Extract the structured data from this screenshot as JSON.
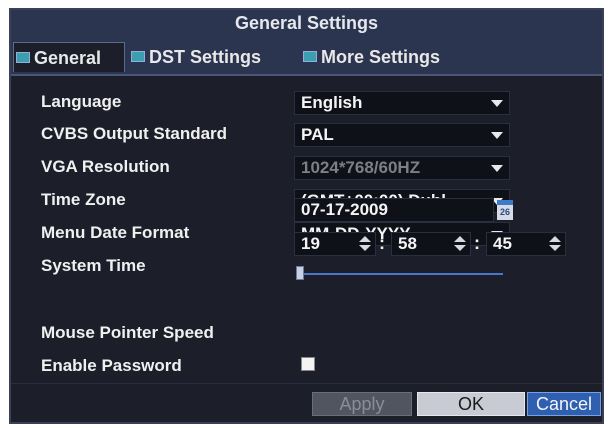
{
  "dialog": {
    "title": "General Settings"
  },
  "tabs": [
    {
      "label": "General",
      "icon": "tab-icon"
    },
    {
      "label": "DST Settings",
      "icon": "tab-icon"
    },
    {
      "label": "More Settings",
      "icon": "tab-icon"
    }
  ],
  "fields": {
    "language": {
      "label": "Language",
      "value": "English"
    },
    "cvbs": {
      "label": "CVBS Output Standard",
      "value": "PAL"
    },
    "vga": {
      "label": "VGA Resolution",
      "value": "1024*768/60HZ"
    },
    "timezone": {
      "label": "Time Zone",
      "value": "(GMT+00:00) Dubl"
    },
    "date_format": {
      "label": "Menu Date Format",
      "value": "MM-DD-YYYY"
    },
    "system_time": {
      "label": "System Time",
      "date": "07-17-2009",
      "calendar_day": "26",
      "hour": "19",
      "minute": "58",
      "second": "45",
      "separator": ":"
    },
    "mouse_speed": {
      "label": "Mouse Pointer Speed",
      "level": 0.0
    },
    "password": {
      "label": "Enable Password",
      "checked": false
    }
  },
  "buttons": {
    "apply": "Apply",
    "ok": "OK",
    "cancel": "Cancel"
  },
  "colors": {
    "background": "#1c1f2a",
    "titlebar": "#2c3550",
    "accent": "#2e5fb0"
  }
}
